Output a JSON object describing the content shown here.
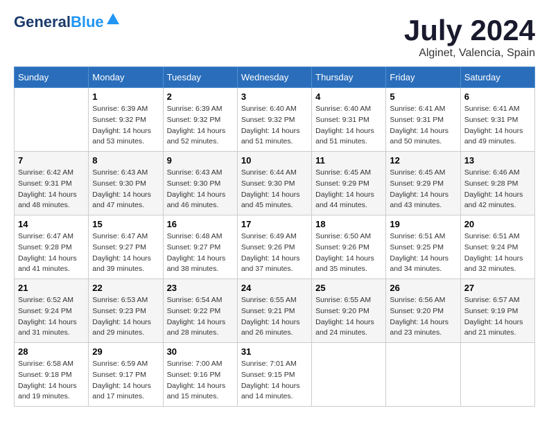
{
  "logo": {
    "line1": "General",
    "line2": "Blue"
  },
  "title": "July 2024",
  "location": "Alginet, Valencia, Spain",
  "days_of_week": [
    "Sunday",
    "Monday",
    "Tuesday",
    "Wednesday",
    "Thursday",
    "Friday",
    "Saturday"
  ],
  "weeks": [
    [
      {
        "day": "",
        "info": ""
      },
      {
        "day": "1",
        "sunrise": "6:39 AM",
        "sunset": "9:32 PM",
        "daylight": "14 hours and 53 minutes."
      },
      {
        "day": "2",
        "sunrise": "6:39 AM",
        "sunset": "9:32 PM",
        "daylight": "14 hours and 52 minutes."
      },
      {
        "day": "3",
        "sunrise": "6:40 AM",
        "sunset": "9:32 PM",
        "daylight": "14 hours and 51 minutes."
      },
      {
        "day": "4",
        "sunrise": "6:40 AM",
        "sunset": "9:31 PM",
        "daylight": "14 hours and 51 minutes."
      },
      {
        "day": "5",
        "sunrise": "6:41 AM",
        "sunset": "9:31 PM",
        "daylight": "14 hours and 50 minutes."
      },
      {
        "day": "6",
        "sunrise": "6:41 AM",
        "sunset": "9:31 PM",
        "daylight": "14 hours and 49 minutes."
      }
    ],
    [
      {
        "day": "7",
        "sunrise": "6:42 AM",
        "sunset": "9:31 PM",
        "daylight": "14 hours and 48 minutes."
      },
      {
        "day": "8",
        "sunrise": "6:43 AM",
        "sunset": "9:30 PM",
        "daylight": "14 hours and 47 minutes."
      },
      {
        "day": "9",
        "sunrise": "6:43 AM",
        "sunset": "9:30 PM",
        "daylight": "14 hours and 46 minutes."
      },
      {
        "day": "10",
        "sunrise": "6:44 AM",
        "sunset": "9:30 PM",
        "daylight": "14 hours and 45 minutes."
      },
      {
        "day": "11",
        "sunrise": "6:45 AM",
        "sunset": "9:29 PM",
        "daylight": "14 hours and 44 minutes."
      },
      {
        "day": "12",
        "sunrise": "6:45 AM",
        "sunset": "9:29 PM",
        "daylight": "14 hours and 43 minutes."
      },
      {
        "day": "13",
        "sunrise": "6:46 AM",
        "sunset": "9:28 PM",
        "daylight": "14 hours and 42 minutes."
      }
    ],
    [
      {
        "day": "14",
        "sunrise": "6:47 AM",
        "sunset": "9:28 PM",
        "daylight": "14 hours and 41 minutes."
      },
      {
        "day": "15",
        "sunrise": "6:47 AM",
        "sunset": "9:27 PM",
        "daylight": "14 hours and 39 minutes."
      },
      {
        "day": "16",
        "sunrise": "6:48 AM",
        "sunset": "9:27 PM",
        "daylight": "14 hours and 38 minutes."
      },
      {
        "day": "17",
        "sunrise": "6:49 AM",
        "sunset": "9:26 PM",
        "daylight": "14 hours and 37 minutes."
      },
      {
        "day": "18",
        "sunrise": "6:50 AM",
        "sunset": "9:26 PM",
        "daylight": "14 hours and 35 minutes."
      },
      {
        "day": "19",
        "sunrise": "6:51 AM",
        "sunset": "9:25 PM",
        "daylight": "14 hours and 34 minutes."
      },
      {
        "day": "20",
        "sunrise": "6:51 AM",
        "sunset": "9:24 PM",
        "daylight": "14 hours and 32 minutes."
      }
    ],
    [
      {
        "day": "21",
        "sunrise": "6:52 AM",
        "sunset": "9:24 PM",
        "daylight": "14 hours and 31 minutes."
      },
      {
        "day": "22",
        "sunrise": "6:53 AM",
        "sunset": "9:23 PM",
        "daylight": "14 hours and 29 minutes."
      },
      {
        "day": "23",
        "sunrise": "6:54 AM",
        "sunset": "9:22 PM",
        "daylight": "14 hours and 28 minutes."
      },
      {
        "day": "24",
        "sunrise": "6:55 AM",
        "sunset": "9:21 PM",
        "daylight": "14 hours and 26 minutes."
      },
      {
        "day": "25",
        "sunrise": "6:55 AM",
        "sunset": "9:20 PM",
        "daylight": "14 hours and 24 minutes."
      },
      {
        "day": "26",
        "sunrise": "6:56 AM",
        "sunset": "9:20 PM",
        "daylight": "14 hours and 23 minutes."
      },
      {
        "day": "27",
        "sunrise": "6:57 AM",
        "sunset": "9:19 PM",
        "daylight": "14 hours and 21 minutes."
      }
    ],
    [
      {
        "day": "28",
        "sunrise": "6:58 AM",
        "sunset": "9:18 PM",
        "daylight": "14 hours and 19 minutes."
      },
      {
        "day": "29",
        "sunrise": "6:59 AM",
        "sunset": "9:17 PM",
        "daylight": "14 hours and 17 minutes."
      },
      {
        "day": "30",
        "sunrise": "7:00 AM",
        "sunset": "9:16 PM",
        "daylight": "14 hours and 15 minutes."
      },
      {
        "day": "31",
        "sunrise": "7:01 AM",
        "sunset": "9:15 PM",
        "daylight": "14 hours and 14 minutes."
      },
      {
        "day": "",
        "info": ""
      },
      {
        "day": "",
        "info": ""
      },
      {
        "day": "",
        "info": ""
      }
    ]
  ],
  "labels": {
    "sunrise": "Sunrise:",
    "sunset": "Sunset:",
    "daylight": "Daylight:"
  }
}
